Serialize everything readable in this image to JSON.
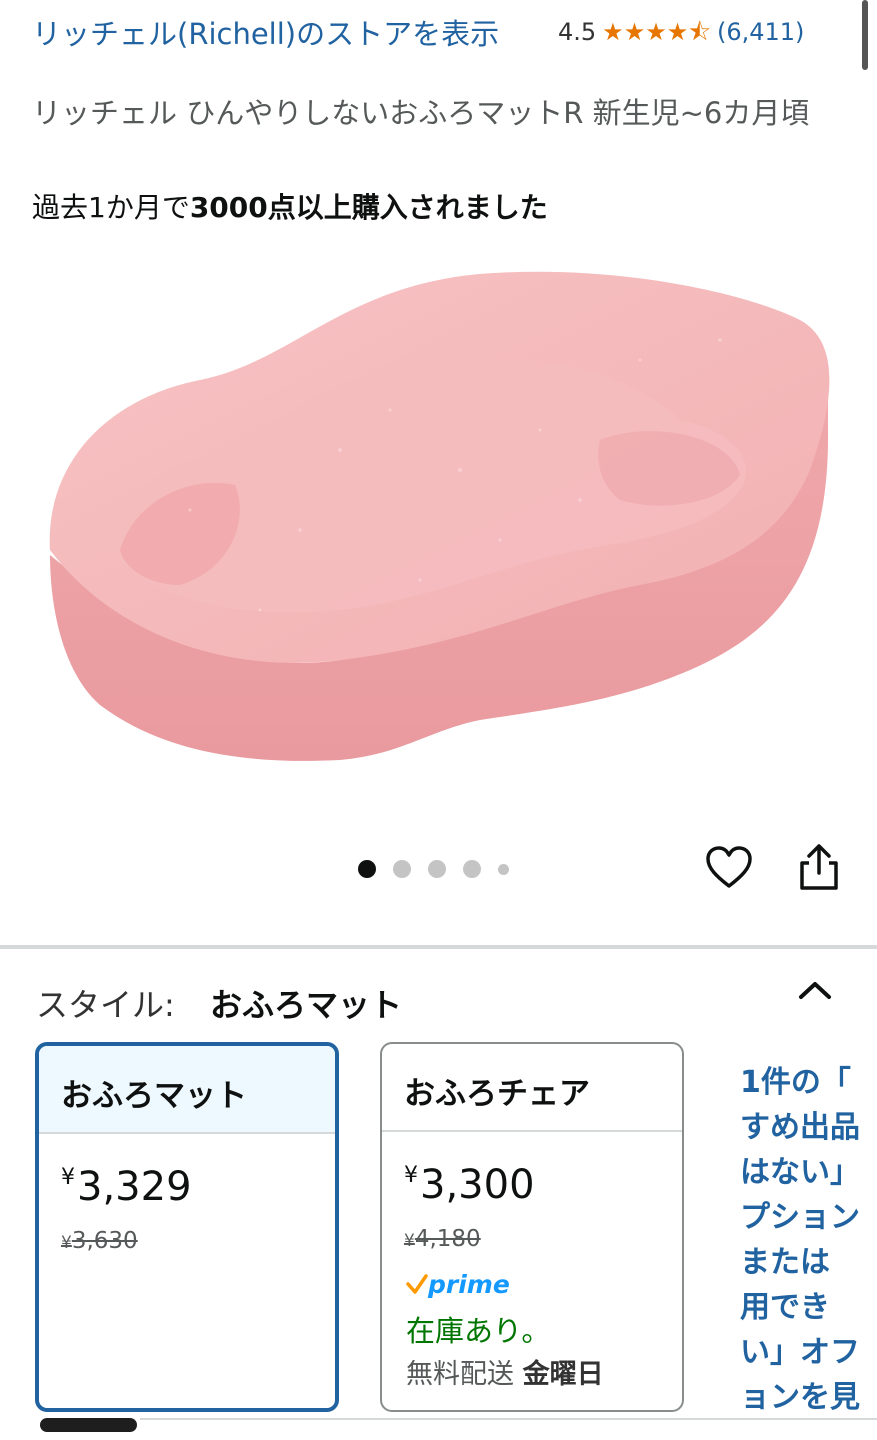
{
  "header": {
    "store_link": "リッチェル(Richell)のストアを表示",
    "rating_value": "4.5",
    "rating_stars": 4.5,
    "rating_count": "(6,411)"
  },
  "product": {
    "title": "リッチェル ひんやりしないおふろマットR 新生児~6カ月頃",
    "purchase_prefix": "過去1か月で",
    "purchase_bold": "3000点以上購入されました",
    "image_dots_total": 5,
    "image_dots_active": 1
  },
  "icons": {
    "heart": "heart-icon",
    "share": "share-icon",
    "chevron": "chevron-up-icon",
    "star": "star-icon"
  },
  "colors": {
    "link": "#2162a1",
    "star": "#e77600",
    "prime": "#1399ff",
    "instock": "#007600",
    "selected_border": "#2162a1",
    "product_pink": "#f4b4b6"
  },
  "style_selector": {
    "label": "スタイル:",
    "value": "おふろマット",
    "options": [
      {
        "name": "おふろマット",
        "currency": "¥",
        "price": "3,329",
        "old_currency": "¥",
        "old_price": "3,630",
        "selected": true
      },
      {
        "name": "おふろチェア",
        "currency": "¥",
        "price": "3,300",
        "old_currency": "¥",
        "old_price": "4,180",
        "prime": "prime",
        "stock": "在庫あり。",
        "delivery_prefix": "無料配送",
        "delivery_day": "金曜日",
        "selected": false
      }
    ],
    "more_offers_lines": [
      "1件の「",
      "すめ出品",
      "はない」",
      "プション",
      "または",
      "用でき",
      "い」オフ",
      "ョンを見"
    ]
  }
}
